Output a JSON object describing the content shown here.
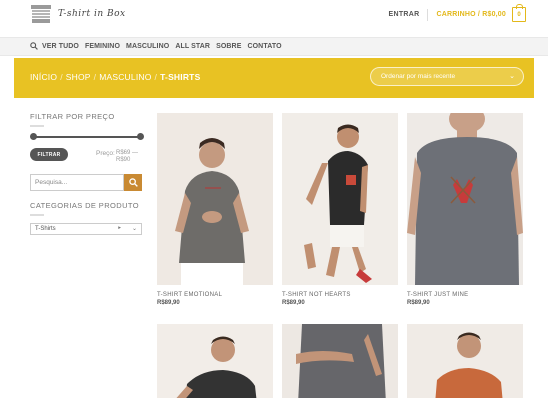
{
  "header": {
    "logo_text": "T-shirt in Box",
    "login_label": "ENTRAR",
    "cart_label": "CARRINHO / R$0,00",
    "cart_count": "0"
  },
  "nav": {
    "items": [
      "VER TUDO",
      "FEMININO",
      "MASCULINO",
      "ALL STAR",
      "SOBRE",
      "CONTATO"
    ]
  },
  "breadcrumb": {
    "items": [
      "INÍCIO",
      "SHOP",
      "MASCULINO"
    ],
    "current": "T-SHIRTS"
  },
  "ordering": {
    "selected": "Ordenar por mais recente"
  },
  "sidebar": {
    "price_filter_title": "FILTRAR POR PREÇO",
    "filter_button": "FILTRAR",
    "price_label": "Preço:",
    "price_range": "R$69 — R$90",
    "search_placeholder": "Pesquisa...",
    "categories_title": "CATEGORIAS DE PRODUTO",
    "category_selected": "T-Shirts",
    "category_count": "4"
  },
  "products": [
    {
      "name": "T-SHIRT EMOTIONAL",
      "price": "R$89,90"
    },
    {
      "name": "T-SHIRT NOT HEARTS",
      "price": "R$89,90"
    },
    {
      "name": "T-SHIRT JUST MINE",
      "price": "R$89,90"
    }
  ],
  "colors": {
    "accent": "#e8c223",
    "cart": "#e3b81a",
    "search_button": "#c98a33"
  }
}
